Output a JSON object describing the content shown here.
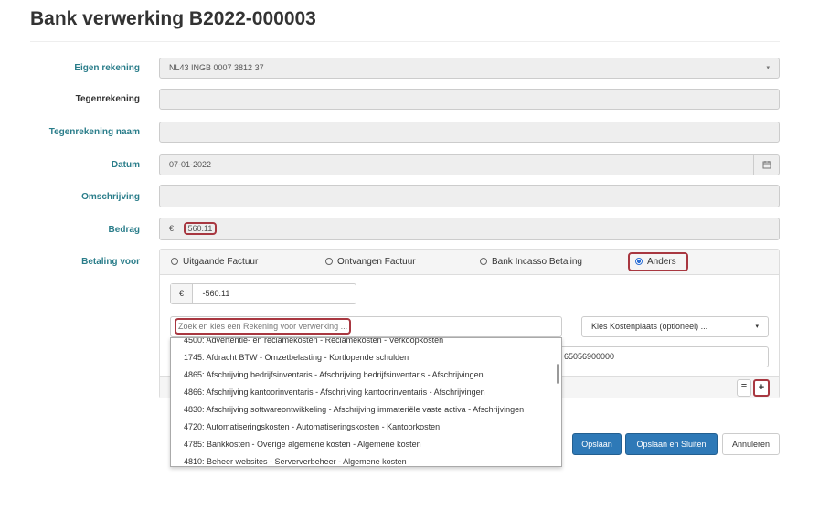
{
  "page": {
    "title": "Bank verwerking B2022-000003"
  },
  "form": {
    "eigen_rekening": {
      "label": "Eigen rekening",
      "value": "NL43 INGB 0007 3812 37"
    },
    "tegenrekening": {
      "label": "Tegenrekening",
      "value": ""
    },
    "tegenrekening_naam": {
      "label": "Tegenrekening naam",
      "value": ""
    },
    "datum": {
      "label": "Datum",
      "value": "07-01-2022"
    },
    "omschrijving": {
      "label": "Omschrijving",
      "value": ""
    },
    "bedrag": {
      "label": "Bedrag",
      "currency": "€",
      "value": "560.11"
    },
    "betaling_voor": {
      "label": "Betaling voor",
      "options": [
        "Uitgaande Factuur",
        "Ontvangen Factuur",
        "Bank Incasso Betaling",
        "Anders"
      ],
      "selected": "Anders"
    }
  },
  "split": {
    "currency": "€",
    "amount": "-560.11",
    "rekening_placeholder": "Zoek en kies een Rekening voor verwerking ...",
    "kostenplaats_placeholder": "Kies Kostenplaats (optioneel) ...",
    "partial_text": "65056900000"
  },
  "dropdown": {
    "items": [
      "4500: Advertentie- en reclamekosten - Reclamekosten - Verkoopkosten",
      "1745: Afdracht BTW - Omzetbelasting - Kortlopende schulden",
      "4865: Afschrijving bedrijfsinventaris - Afschrijving bedrijfsinventaris - Afschrijvingen",
      "4866: Afschrijving kantoorinventaris - Afschrijving kantoorinventaris - Afschrijvingen",
      "4830: Afschrijving softwareontwikkeling - Afschrijving immateriële vaste activa - Afschrijvingen",
      "4720: Automatiseringskosten - Automatiseringskosten - Kantoorkosten",
      "4785: Bankkosten - Overige algemene kosten - Algemene kosten",
      "4810: Beheer websites - Serververbeheer - Algemene kosten"
    ]
  },
  "buttons": {
    "save": "Opslaan",
    "save_close": "Opslaan en Sluiten",
    "cancel": "Annuleren"
  },
  "icons": {
    "list": "≡",
    "add": "+",
    "calendar": "calendar-icon",
    "caret": "▾"
  },
  "colors": {
    "label": "#2a7d8a",
    "highlight": "#a83740",
    "primary": "#2e79b7"
  }
}
